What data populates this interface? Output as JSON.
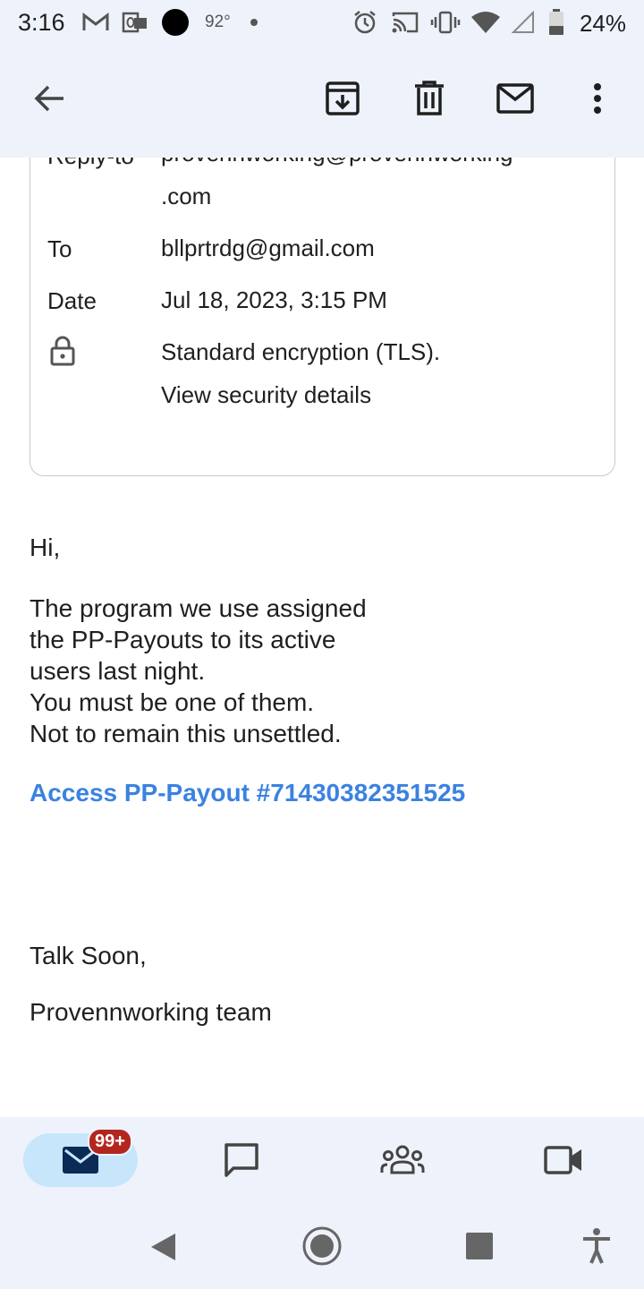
{
  "status_bar": {
    "time": "3:16",
    "temperature": "92°",
    "battery_percent": "24%"
  },
  "app_bar": {
    "icons": [
      "back-arrow-icon",
      "archive-icon",
      "delete-icon",
      "mark-unread-icon",
      "more-vert-icon"
    ]
  },
  "details": {
    "reply_to_label": "Reply-to",
    "reply_to_value_line1": "provennworking@provennworking",
    "reply_to_value_line2": ".com",
    "to_label": "To",
    "to_value": "bllprtrdg@gmail.com",
    "date_label": "Date",
    "date_value": "Jul 18, 2023, 3:15 PM",
    "security_line1": "Standard encryption (TLS).",
    "security_line2": "View security details"
  },
  "email_body": {
    "greeting": "Hi,",
    "paragraph_lines": [
      "The program we use assigned",
      "the PP-Payouts to its active",
      "users last night.",
      "You must be one of them.",
      "Not to remain this unsettled."
    ],
    "link_text": "Access PP-Payout #71430382351525",
    "signoff": "Talk Soon,",
    "signature": "Provennworking team"
  },
  "bottom_nav": {
    "mail_badge": "99+",
    "items": [
      "mail-icon",
      "chat-icon",
      "spaces-icon",
      "meet-icon"
    ]
  },
  "colors": {
    "accent_link": "#3b82e0",
    "bar_background": "#eef2fb",
    "active_pill": "#c8e6fb",
    "badge_red": "#b3261e"
  }
}
